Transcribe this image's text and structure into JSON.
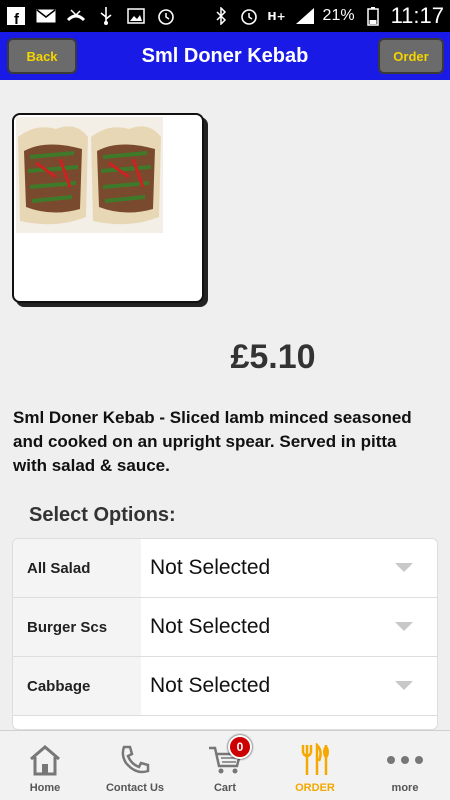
{
  "status_bar": {
    "battery_percent": "21%",
    "time": "11:17",
    "network": "H+"
  },
  "header": {
    "title": "Sml Doner Kebab",
    "back_label": "Back",
    "order_label": "Order",
    "bar_color": "#1a1ae6",
    "button_text_color": "#f5d400"
  },
  "product": {
    "price": "£5.10",
    "description": "Sml Doner Kebab - Sliced lamb minced seasoned and cooked on an upright spear. Served in pitta with salad & sauce."
  },
  "options": {
    "title": "Select Options:",
    "items": [
      {
        "label": "All Salad",
        "value": "Not Selected"
      },
      {
        "label": "Burger Scs",
        "value": "Not Selected"
      },
      {
        "label": "Cabbage",
        "value": "Not Selected"
      }
    ]
  },
  "bottom_nav": {
    "items": [
      {
        "label": "Home",
        "icon": "home-icon"
      },
      {
        "label": "Contact Us",
        "icon": "phone-icon"
      },
      {
        "label": "Cart",
        "icon": "cart-icon",
        "badge": "0"
      },
      {
        "label": "ORDER",
        "icon": "cutlery-icon",
        "active": true
      },
      {
        "label": "more",
        "icon": "more-icon"
      }
    ],
    "active_color": "#f5a800"
  }
}
